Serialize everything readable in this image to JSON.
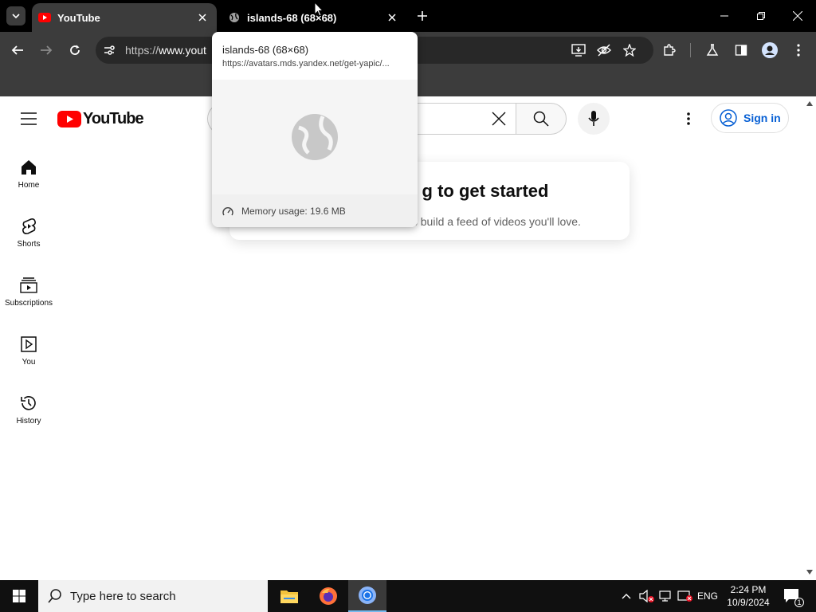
{
  "browser": {
    "tabs": [
      {
        "title": "YouTube",
        "active": true
      },
      {
        "title": "islands-68 (68×68)",
        "active": false
      }
    ],
    "url_prefix": "https://",
    "url_host": "www.yout"
  },
  "hover_card": {
    "title": "islands-68 (68×68)",
    "url": "https://avatars.mds.yandex.net/get-yapic/...",
    "memory": "Memory usage: 19.6 MB"
  },
  "youtube": {
    "logo_text": "YouTube",
    "sidebar": [
      {
        "label": "Home",
        "icon": "home-icon"
      },
      {
        "label": "Shorts",
        "icon": "shorts-icon"
      },
      {
        "label": "Subscriptions",
        "icon": "subscriptions-icon"
      },
      {
        "label": "You",
        "icon": "you-icon"
      },
      {
        "label": "History",
        "icon": "history-icon"
      }
    ],
    "signin_label": "Sign in",
    "card": {
      "heading_visible": "g to get started",
      "text_visible": "us build a feed of videos you'll love."
    }
  },
  "taskbar": {
    "search_placeholder": "Type here to search",
    "lang": "ENG",
    "time": "2:24 PM",
    "date": "10/9/2024",
    "notification_count": "1"
  },
  "colors": {
    "youtube_red": "#ff0000",
    "link_blue": "#065fd4",
    "chrome_dark": "#3c3c3c"
  }
}
